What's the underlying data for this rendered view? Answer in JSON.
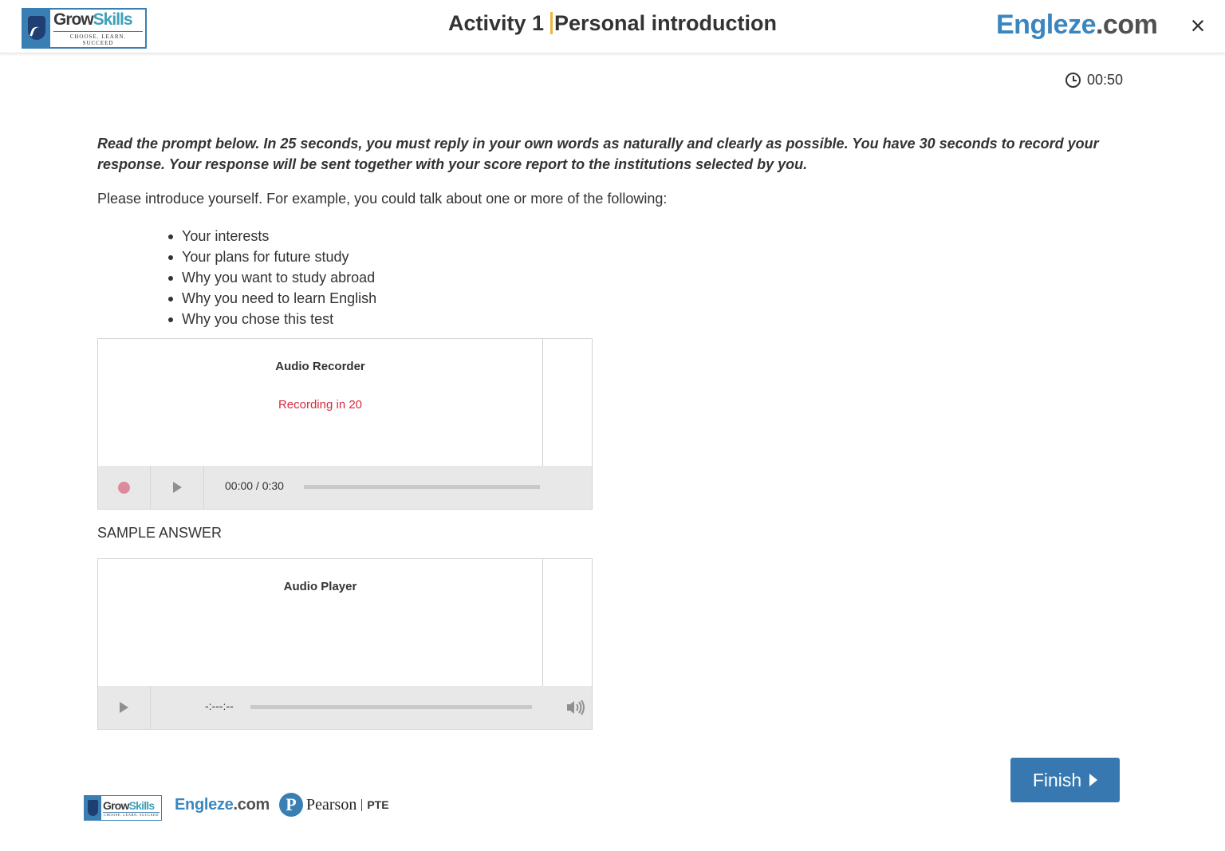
{
  "header": {
    "logo": {
      "word1": "Grow",
      "word2": "Skills",
      "tagline": "CHOOSE. LEARN. SUCCEED"
    },
    "activity": "Activity 1",
    "activity_title": "Personal introduction",
    "brand": {
      "part1": "Engleze",
      "part2": ".com"
    },
    "close_icon": "×"
  },
  "timer": {
    "icon": "clock-icon",
    "value": "00:50"
  },
  "instructions": "Read the prompt below. In 25 seconds, you must reply in your own words as naturally and clearly as possible. You have 30 seconds to record your response. Your response will be sent together with your score report to the institutions selected by you.",
  "prompt": "Please introduce yourself. For example, you could talk about one or more of the following:",
  "bullets": [
    "Your interests",
    "Your plans for future study",
    "Why you want to study abroad",
    "Why you need to learn English",
    "Why you chose this test"
  ],
  "recorder": {
    "label": "Audio Recorder",
    "status": "Recording in 20",
    "time": "00:00 / 0:30",
    "progress": 0
  },
  "sample_answer_label": "SAMPLE ANSWER",
  "player": {
    "label": "Audio Player",
    "time": "-:---:--",
    "progress": 0
  },
  "finish_button": "Finish",
  "footer": {
    "growskills": {
      "word1": "Grow",
      "word2": "Skills",
      "tagline": "CHOOSE. LEARN. SUCCEED"
    },
    "engleze": {
      "part1": "Engleze",
      "part2": ".com"
    },
    "pearson": {
      "mark": "P",
      "name": "Pearson",
      "product": "PTE"
    }
  },
  "colors": {
    "accent_blue": "#3878b0",
    "title_divider": "#f0b43c",
    "recording_red": "#d9283f"
  }
}
